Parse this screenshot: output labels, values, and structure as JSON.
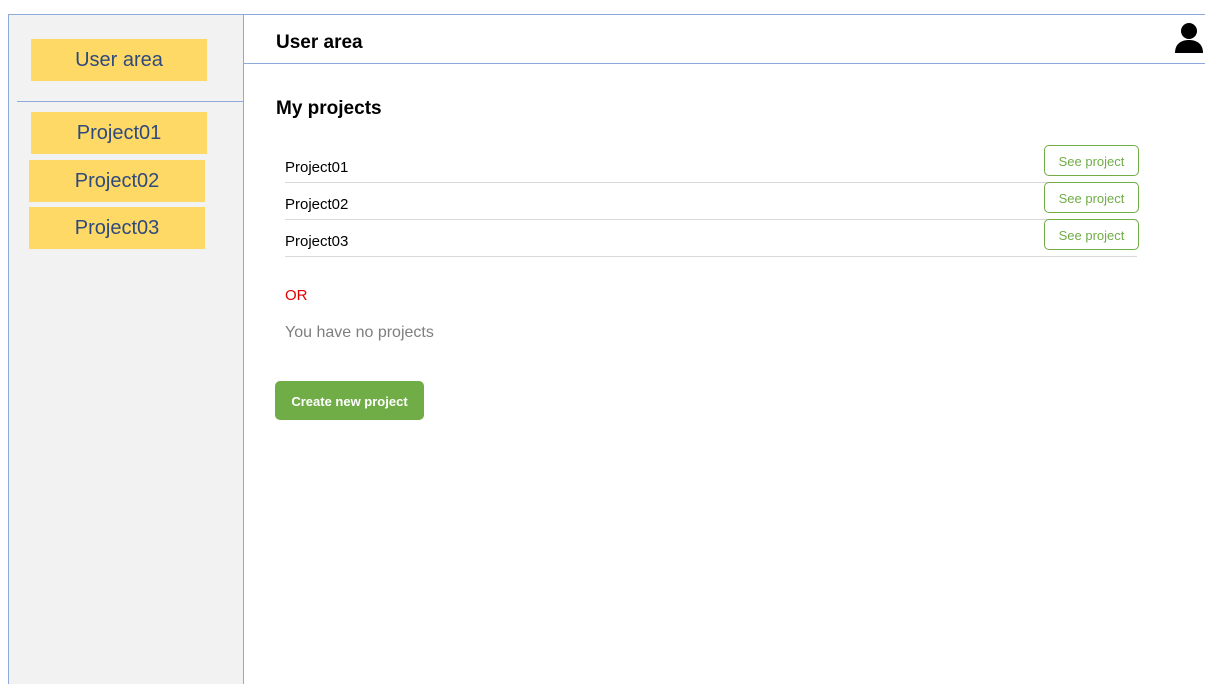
{
  "sidebar": {
    "header_label": "User area",
    "items": [
      {
        "label": "Project01"
      },
      {
        "label": "Project02"
      },
      {
        "label": "Project03"
      }
    ]
  },
  "header": {
    "title": "User area",
    "user_icon": "user-icon"
  },
  "main": {
    "section_title": "My projects",
    "projects": [
      {
        "name": "Project01",
        "action_label": "See project"
      },
      {
        "name": "Project02",
        "action_label": "See project"
      },
      {
        "name": "Project03",
        "action_label": "See project"
      }
    ],
    "or_label": "OR",
    "empty_message": "You have no projects",
    "create_button_label": "Create new project"
  },
  "colors": {
    "sidebar_button": "#ffd966",
    "sidebar_text": "#2e4a7d",
    "accent_green": "#70ad47",
    "or_red": "#e00000",
    "border_blue": "#8eaadb"
  }
}
